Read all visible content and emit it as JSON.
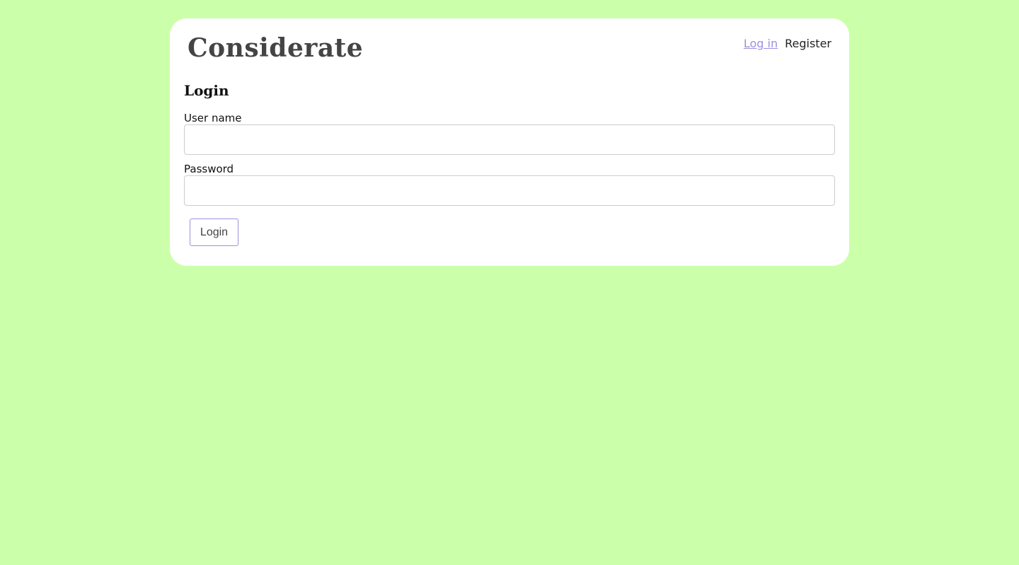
{
  "app": {
    "brand": "Considerate"
  },
  "nav": {
    "items": [
      {
        "label": "Log in",
        "current": true
      },
      {
        "label": "Register",
        "current": false
      }
    ]
  },
  "login_form": {
    "title": "Login",
    "username_label": "User name",
    "username_value": "",
    "password_label": "Password",
    "password_value": "",
    "submit_label": "Login"
  },
  "colors": {
    "page_background": "#ccffaa",
    "card_background": "#ffffff",
    "accent": "#9d8fe0",
    "brand_text": "#444444"
  }
}
